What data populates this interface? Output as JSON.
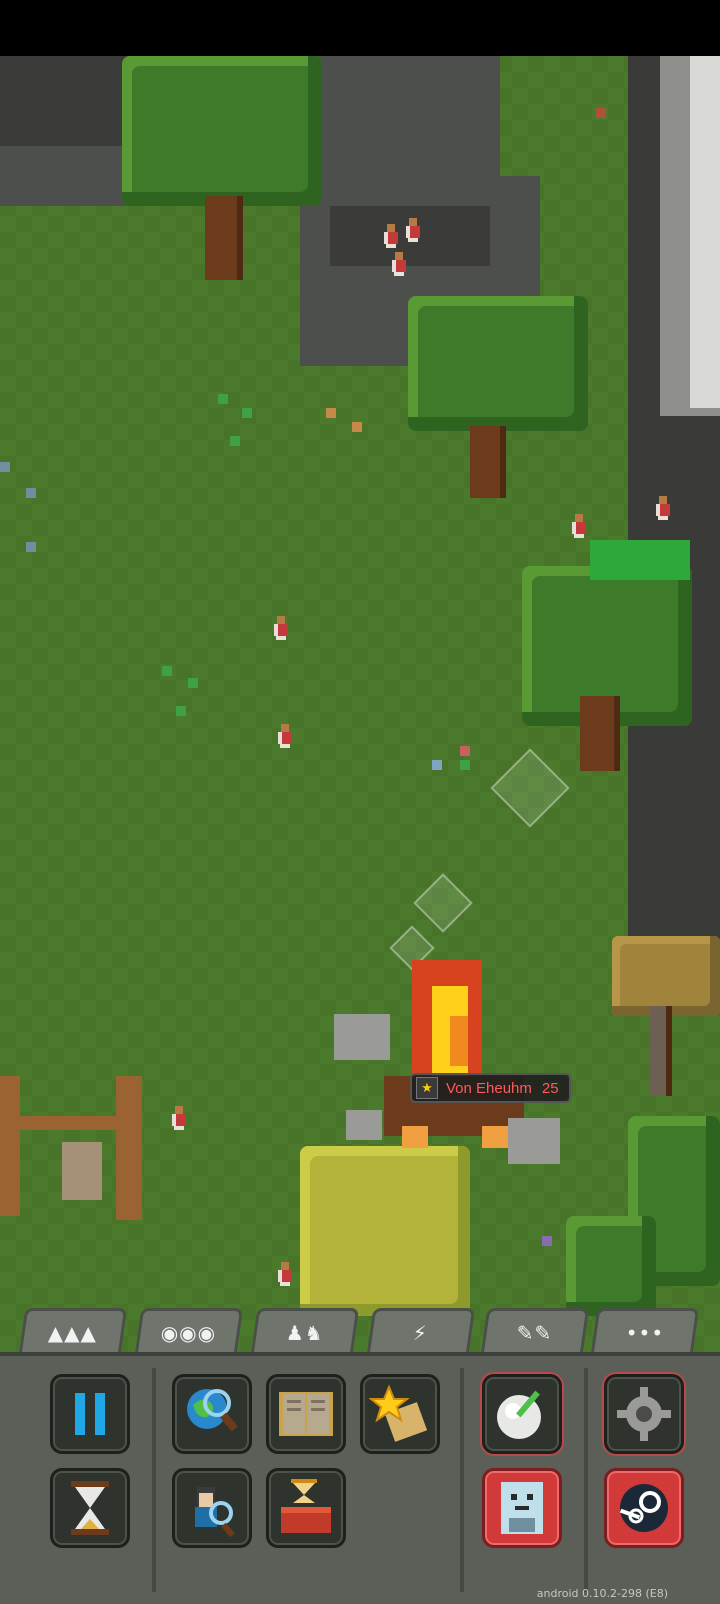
{
  "world": {
    "selected_unit": {
      "name": "Von Eheuhm",
      "level": "25"
    }
  },
  "tabs": [
    {
      "id": "terrain",
      "icon": "mountains-icon",
      "glyph": "▲▲▲"
    },
    {
      "id": "creatures",
      "icon": "creatures-icon",
      "glyph": "◉◉◉"
    },
    {
      "id": "civilizations",
      "icon": "human-sheep-icon",
      "glyph": "♟♞"
    },
    {
      "id": "disasters",
      "icon": "lightning-icon",
      "glyph": "⚡"
    },
    {
      "id": "tools",
      "icon": "tools-icon",
      "glyph": "✎✎"
    },
    {
      "id": "more",
      "icon": "more-icon",
      "glyph": "•••"
    }
  ],
  "buttons": {
    "pause": {
      "icon": "pause-icon"
    },
    "world_info": {
      "icon": "globe-magnifier-icon"
    },
    "history": {
      "icon": "open-book-icon"
    },
    "achievements": {
      "icon": "star-scroll-icon"
    },
    "time_speed": {
      "icon": "hourglass-icon"
    },
    "unit_finder": {
      "icon": "person-magnifier-icon"
    },
    "world_laws": {
      "icon": "hourglass-book-icon"
    },
    "brush": {
      "icon": "brush-orb-icon"
    },
    "settings": {
      "icon": "gear-icon"
    },
    "save": {
      "icon": "floppy-face-icon"
    },
    "steam": {
      "icon": "steam-icon"
    }
  },
  "version": "android 0.10.2-298 (E8)"
}
